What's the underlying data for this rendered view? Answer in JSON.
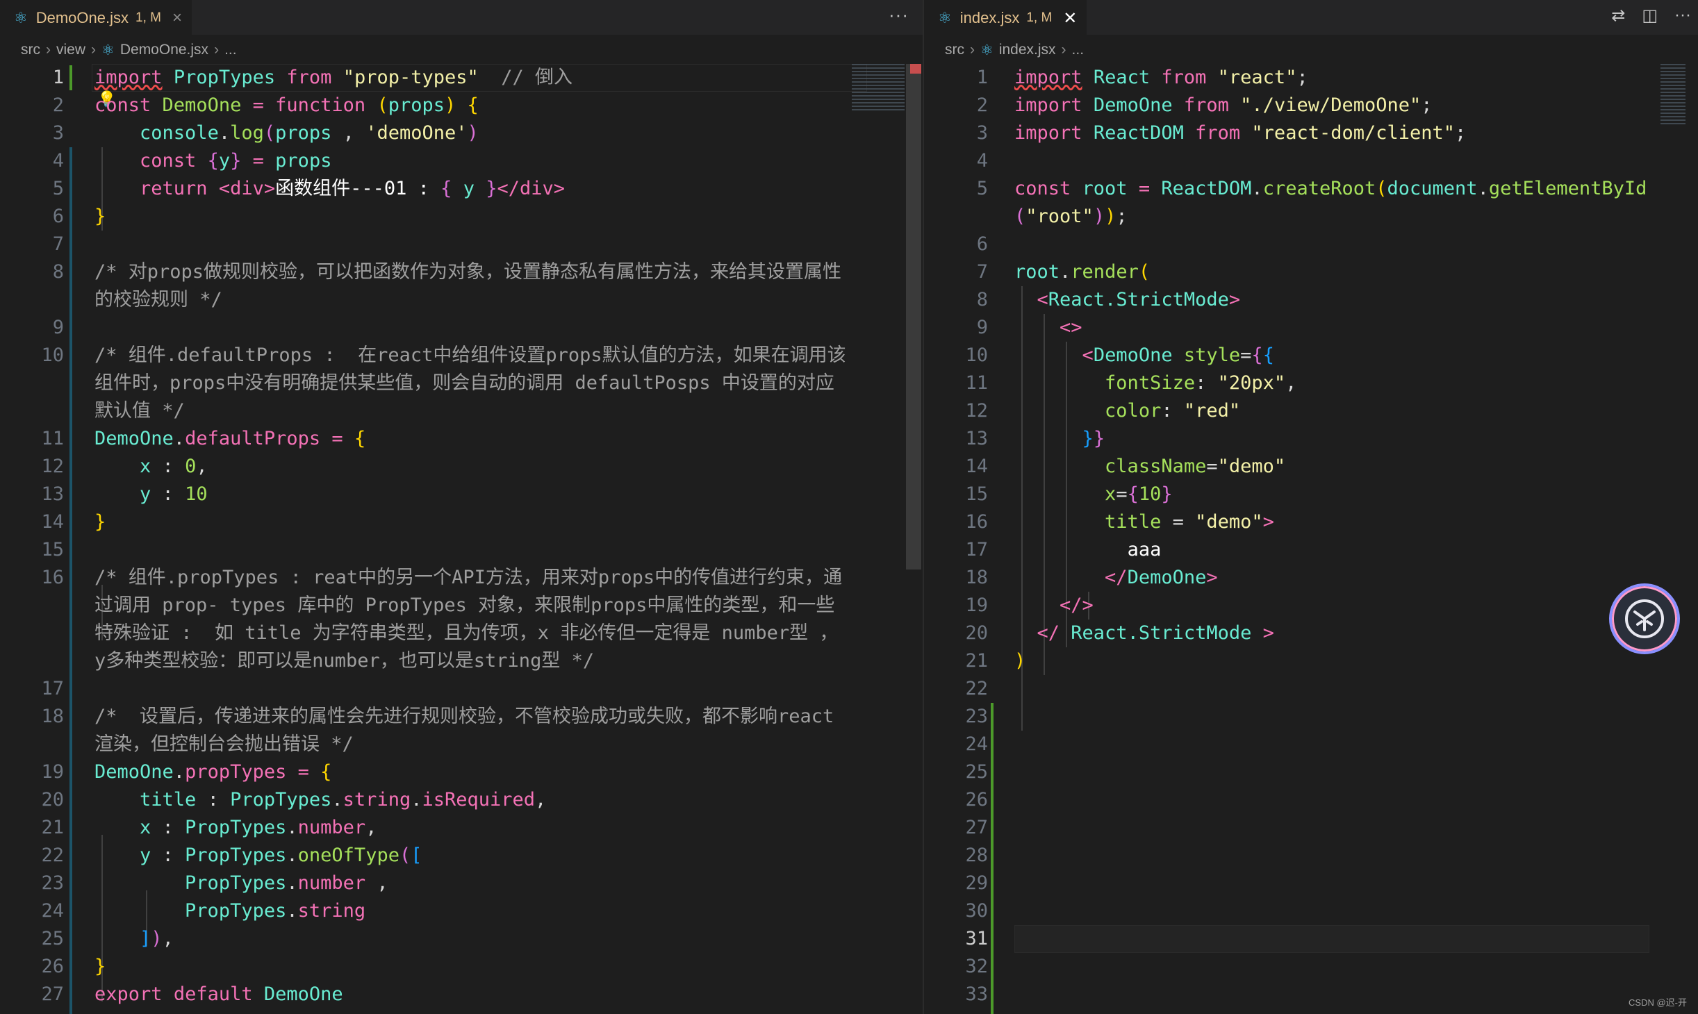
{
  "left": {
    "tab": {
      "icon": "react-icon",
      "filename": "DemoOne.jsx",
      "badge": "1, M",
      "close": "×"
    },
    "more": "···",
    "breadcrumb": [
      "src",
      "view",
      "DemoOne.jsx",
      "..."
    ],
    "lines": [
      {
        "n": "1",
        "segs": [
          [
            "kw wavy",
            "import"
          ],
          [
            "pl",
            " "
          ],
          [
            "id",
            "PropTypes"
          ],
          [
            "pl",
            " "
          ],
          [
            "kw",
            "from"
          ],
          [
            "pl",
            " "
          ],
          [
            "str",
            "\"prop-types\""
          ],
          [
            "pl",
            "  "
          ],
          [
            "com",
            "// 倒入"
          ]
        ]
      },
      {
        "n": "2",
        "segs": [
          [
            "kw",
            "const"
          ],
          [
            "pl",
            " "
          ],
          [
            "fn",
            "DemoOne"
          ],
          [
            "pl",
            " "
          ],
          [
            "kw",
            "="
          ],
          [
            "pl",
            " "
          ],
          [
            "kw",
            "function"
          ],
          [
            "pl",
            " "
          ],
          [
            "br1",
            "("
          ],
          [
            "id",
            "props"
          ],
          [
            "br1",
            ")"
          ],
          [
            "pl",
            " "
          ],
          [
            "br1",
            "{"
          ]
        ]
      },
      {
        "n": "3",
        "segs": [
          [
            "pl",
            "    "
          ],
          [
            "id",
            "console"
          ],
          [
            "pl",
            "."
          ],
          [
            "fn",
            "log"
          ],
          [
            "br2",
            "("
          ],
          [
            "id",
            "props"
          ],
          [
            "pl",
            " , "
          ],
          [
            "str",
            "'demoOne'"
          ],
          [
            "br2",
            ")"
          ]
        ]
      },
      {
        "n": "4",
        "segs": [
          [
            "pl",
            "    "
          ],
          [
            "kw",
            "const"
          ],
          [
            "pl",
            " "
          ],
          [
            "br2",
            "{"
          ],
          [
            "id",
            "y"
          ],
          [
            "br2",
            "}"
          ],
          [
            "pl",
            " "
          ],
          [
            "kw",
            "="
          ],
          [
            "pl",
            " "
          ],
          [
            "id",
            "props"
          ]
        ]
      },
      {
        "n": "5",
        "segs": [
          [
            "pl",
            "    "
          ],
          [
            "kw",
            "return"
          ],
          [
            "pl",
            " "
          ],
          [
            "tag",
            "<div>"
          ],
          [
            "wht",
            "函数组件---01 : "
          ],
          [
            "br2",
            "{"
          ],
          [
            "pl",
            " "
          ],
          [
            "id",
            "y"
          ],
          [
            "pl",
            " "
          ],
          [
            "br2",
            "}"
          ],
          [
            "tag",
            "</div>"
          ]
        ]
      },
      {
        "n": "6",
        "segs": [
          [
            "br1",
            "}"
          ]
        ]
      },
      {
        "n": "7",
        "segs": []
      },
      {
        "n": "8",
        "segs": [
          [
            "com",
            "/* 对props做规则校验，可以把函数作为对象，设置静态私有属性方法，来给其设置属性"
          ]
        ]
      },
      {
        "n": "",
        "segs": [
          [
            "com",
            "的校验规则 */"
          ]
        ]
      },
      {
        "n": "9",
        "segs": []
      },
      {
        "n": "10",
        "segs": [
          [
            "com",
            "/* 组件.defaultProps :  在react中给组件设置props默认值的方法，如果在调用该"
          ]
        ]
      },
      {
        "n": "",
        "segs": [
          [
            "com",
            "组件时，props中没有明确提供某些值，则会自动的调用 defaultPosps 中设置的对应"
          ]
        ]
      },
      {
        "n": "",
        "segs": [
          [
            "com",
            "默认值 */"
          ]
        ]
      },
      {
        "n": "11",
        "segs": [
          [
            "id",
            "DemoOne"
          ],
          [
            "pl",
            "."
          ],
          [
            "kw",
            "defaultProps"
          ],
          [
            "pl",
            " "
          ],
          [
            "kw",
            "="
          ],
          [
            "pl",
            " "
          ],
          [
            "br1",
            "{"
          ]
        ]
      },
      {
        "n": "12",
        "segs": [
          [
            "pl",
            "    "
          ],
          [
            "id",
            "x"
          ],
          [
            "pl",
            " : "
          ],
          [
            "num",
            "0"
          ],
          [
            "pl",
            ","
          ]
        ]
      },
      {
        "n": "13",
        "segs": [
          [
            "pl",
            "    "
          ],
          [
            "id",
            "y"
          ],
          [
            "pl",
            " : "
          ],
          [
            "num",
            "10"
          ]
        ]
      },
      {
        "n": "14",
        "segs": [
          [
            "br1",
            "}"
          ]
        ]
      },
      {
        "n": "15",
        "segs": []
      },
      {
        "n": "16",
        "segs": [
          [
            "com",
            "/* 组件.propTypes : reat中的另一个API方法，用来对props中的传值进行约束，通"
          ]
        ]
      },
      {
        "n": "",
        "segs": [
          [
            "com",
            "过调用 prop- types 库中的 PropTypes 对象，来限制props中属性的类型，和一些"
          ]
        ]
      },
      {
        "n": "",
        "segs": [
          [
            "com",
            "特殊验证 :  如 title 为字符串类型，且为传项，x 非必传但一定得是 number型 ，"
          ]
        ]
      },
      {
        "n": "",
        "segs": [
          [
            "com",
            "y多种类型校验：即可以是number，也可以是string型 */"
          ]
        ]
      },
      {
        "n": "17",
        "segs": []
      },
      {
        "n": "18",
        "segs": [
          [
            "com",
            "/*  设置后，传递进来的属性会先进行规则校验，不管校验成功或失败，都不影响react"
          ]
        ]
      },
      {
        "n": "",
        "segs": [
          [
            "com",
            "渲染，但控制台会抛出错误 */"
          ]
        ]
      },
      {
        "n": "19",
        "segs": [
          [
            "id",
            "DemoOne"
          ],
          [
            "pl",
            "."
          ],
          [
            "kw",
            "propTypes"
          ],
          [
            "pl",
            " "
          ],
          [
            "kw",
            "="
          ],
          [
            "pl",
            " "
          ],
          [
            "br1",
            "{"
          ]
        ]
      },
      {
        "n": "20",
        "segs": [
          [
            "pl",
            "    "
          ],
          [
            "id",
            "title"
          ],
          [
            "pl",
            " : "
          ],
          [
            "id",
            "PropTypes"
          ],
          [
            "pl",
            "."
          ],
          [
            "kw",
            "string"
          ],
          [
            "pl",
            "."
          ],
          [
            "kw",
            "isRequired"
          ],
          [
            "pl",
            ","
          ]
        ]
      },
      {
        "n": "21",
        "segs": [
          [
            "pl",
            "    "
          ],
          [
            "id",
            "x"
          ],
          [
            "pl",
            " : "
          ],
          [
            "id",
            "PropTypes"
          ],
          [
            "pl",
            "."
          ],
          [
            "kw",
            "number"
          ],
          [
            "pl",
            ","
          ]
        ]
      },
      {
        "n": "22",
        "segs": [
          [
            "pl",
            "    "
          ],
          [
            "id",
            "y"
          ],
          [
            "pl",
            " : "
          ],
          [
            "id",
            "PropTypes"
          ],
          [
            "pl",
            "."
          ],
          [
            "fn",
            "oneOfType"
          ],
          [
            "br2",
            "("
          ],
          [
            "br3",
            "["
          ]
        ]
      },
      {
        "n": "23",
        "segs": [
          [
            "pl",
            "        "
          ],
          [
            "id",
            "PropTypes"
          ],
          [
            "pl",
            "."
          ],
          [
            "kw",
            "number"
          ],
          [
            "pl",
            " ,"
          ]
        ]
      },
      {
        "n": "24",
        "segs": [
          [
            "pl",
            "        "
          ],
          [
            "id",
            "PropTypes"
          ],
          [
            "pl",
            "."
          ],
          [
            "kw",
            "string"
          ]
        ]
      },
      {
        "n": "25",
        "segs": [
          [
            "pl",
            "    "
          ],
          [
            "br3",
            "]"
          ],
          [
            "br2",
            ")"
          ],
          [
            "pl",
            ","
          ]
        ]
      },
      {
        "n": "26",
        "segs": [
          [
            "br1",
            "}"
          ]
        ]
      },
      {
        "n": "27",
        "segs": [
          [
            "kw",
            "export"
          ],
          [
            "pl",
            " "
          ],
          [
            "kw",
            "default"
          ],
          [
            "pl",
            " "
          ],
          [
            "id",
            "DemoOne"
          ]
        ]
      }
    ]
  },
  "right": {
    "tab": {
      "icon": "react-icon",
      "filename": "index.jsx",
      "badge": "1, M",
      "close": "✕"
    },
    "actions": [
      "⇄",
      "◫",
      "···"
    ],
    "breadcrumb": [
      "src",
      "index.jsx",
      "..."
    ],
    "lines": [
      {
        "n": "1",
        "segs": [
          [
            "kw wavy",
            "import"
          ],
          [
            "pl",
            " "
          ],
          [
            "id",
            "React"
          ],
          [
            "pl",
            " "
          ],
          [
            "kw",
            "from"
          ],
          [
            "pl",
            " "
          ],
          [
            "str",
            "\"react\""
          ],
          [
            "pl",
            ";"
          ]
        ]
      },
      {
        "n": "2",
        "segs": [
          [
            "kw",
            "import"
          ],
          [
            "pl",
            " "
          ],
          [
            "id",
            "DemoOne"
          ],
          [
            "pl",
            " "
          ],
          [
            "kw",
            "from"
          ],
          [
            "pl",
            " "
          ],
          [
            "str",
            "\"./view/DemoOne\""
          ],
          [
            "pl",
            ";"
          ]
        ]
      },
      {
        "n": "3",
        "segs": [
          [
            "kw",
            "import"
          ],
          [
            "pl",
            " "
          ],
          [
            "id",
            "ReactDOM"
          ],
          [
            "pl",
            " "
          ],
          [
            "kw",
            "from"
          ],
          [
            "pl",
            " "
          ],
          [
            "str",
            "\"react-dom/client\""
          ],
          [
            "pl",
            ";"
          ]
        ]
      },
      {
        "n": "4",
        "segs": []
      },
      {
        "n": "5",
        "segs": [
          [
            "kw",
            "const"
          ],
          [
            "pl",
            " "
          ],
          [
            "id",
            "root"
          ],
          [
            "pl",
            " "
          ],
          [
            "kw",
            "="
          ],
          [
            "pl",
            " "
          ],
          [
            "id",
            "ReactDOM"
          ],
          [
            "pl",
            "."
          ],
          [
            "fn",
            "createRoot"
          ],
          [
            "br1",
            "("
          ],
          [
            "id",
            "document"
          ],
          [
            "pl",
            "."
          ],
          [
            "fn",
            "getElementById"
          ]
        ]
      },
      {
        "n": "",
        "segs": [
          [
            "br2",
            "("
          ],
          [
            "str",
            "\"root\""
          ],
          [
            "br2",
            ")"
          ],
          [
            "br1",
            ")"
          ],
          [
            "pl",
            ";"
          ]
        ]
      },
      {
        "n": "6",
        "segs": []
      },
      {
        "n": "7",
        "segs": [
          [
            "id",
            "root"
          ],
          [
            "pl",
            "."
          ],
          [
            "fn",
            "render"
          ],
          [
            "br1",
            "("
          ]
        ]
      },
      {
        "n": "8",
        "segs": [
          [
            "pl",
            "  "
          ],
          [
            "tag",
            "<"
          ],
          [
            "id",
            "React.StrictMode"
          ],
          [
            "tag",
            ">"
          ]
        ]
      },
      {
        "n": "9",
        "segs": [
          [
            "pl",
            "    "
          ],
          [
            "tag",
            "<>"
          ]
        ]
      },
      {
        "n": "10",
        "segs": [
          [
            "pl",
            "      "
          ],
          [
            "tag",
            "<"
          ],
          [
            "id",
            "DemoOne"
          ],
          [
            "pl",
            " "
          ],
          [
            "fn",
            "style"
          ],
          [
            "pl",
            "="
          ],
          [
            "br2",
            "{"
          ],
          [
            "br3",
            "{"
          ]
        ]
      },
      {
        "n": "11",
        "segs": [
          [
            "pl",
            "        "
          ],
          [
            "fn",
            "fontSize"
          ],
          [
            "pl",
            ": "
          ],
          [
            "str",
            "\"20px\""
          ],
          [
            "pl",
            ","
          ]
        ]
      },
      {
        "n": "12",
        "segs": [
          [
            "pl",
            "        "
          ],
          [
            "fn",
            "color"
          ],
          [
            "pl",
            ": "
          ],
          [
            "str",
            "\"red\""
          ]
        ]
      },
      {
        "n": "13",
        "segs": [
          [
            "pl",
            "      "
          ],
          [
            "br3",
            "}"
          ],
          [
            "br2",
            "}"
          ]
        ]
      },
      {
        "n": "14",
        "segs": [
          [
            "pl",
            "        "
          ],
          [
            "fn",
            "className"
          ],
          [
            "pl",
            "="
          ],
          [
            "str",
            "\"demo\""
          ]
        ]
      },
      {
        "n": "15",
        "segs": [
          [
            "pl",
            "        "
          ],
          [
            "fn",
            "x"
          ],
          [
            "pl",
            "="
          ],
          [
            "br2",
            "{"
          ],
          [
            "num",
            "10"
          ],
          [
            "br2",
            "}"
          ]
        ]
      },
      {
        "n": "16",
        "segs": [
          [
            "pl",
            "        "
          ],
          [
            "fn",
            "title"
          ],
          [
            "pl",
            " = "
          ],
          [
            "str",
            "\"demo\""
          ],
          [
            "tag",
            ">"
          ]
        ]
      },
      {
        "n": "17",
        "segs": [
          [
            "pl",
            "          "
          ],
          [
            "wht",
            "aaa"
          ]
        ]
      },
      {
        "n": "18",
        "segs": [
          [
            "pl",
            "        "
          ],
          [
            "tag",
            "</"
          ],
          [
            "id",
            "DemoOne"
          ],
          [
            "tag",
            ">"
          ]
        ]
      },
      {
        "n": "19",
        "segs": [
          [
            "pl",
            "    "
          ],
          [
            "tag",
            "</>"
          ]
        ]
      },
      {
        "n": "20",
        "segs": [
          [
            "pl",
            "  "
          ],
          [
            "tag",
            "</ "
          ],
          [
            "id",
            "React.StrictMode"
          ],
          [
            "tag",
            " >"
          ]
        ]
      },
      {
        "n": "21",
        "segs": [
          [
            "br1",
            ")"
          ]
        ]
      },
      {
        "n": "22",
        "segs": []
      },
      {
        "n": "23",
        "segs": []
      },
      {
        "n": "24",
        "segs": []
      },
      {
        "n": "25",
        "segs": []
      },
      {
        "n": "26",
        "segs": []
      },
      {
        "n": "27",
        "segs": []
      },
      {
        "n": "28",
        "segs": []
      },
      {
        "n": "29",
        "segs": []
      },
      {
        "n": "30",
        "segs": []
      },
      {
        "n": "31",
        "segs": []
      },
      {
        "n": "32",
        "segs": []
      },
      {
        "n": "33",
        "segs": []
      }
    ]
  },
  "watermark": "CSDN @迟-开",
  "colors": {
    "keyword": "#f472b6",
    "identifier": "#69ecd2",
    "function": "#a5e05b",
    "string": "#f3f0a8",
    "comment": "#9e9e9e",
    "modified": "#e2c08d",
    "react": "#4fc1e9",
    "gitAdded": "#4c9a2a"
  }
}
